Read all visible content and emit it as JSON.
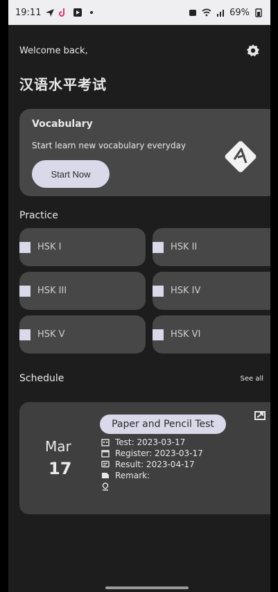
{
  "status_bar": {
    "time": "19:11",
    "battery": "69%"
  },
  "header": {
    "welcome": "Welcome back,",
    "title": "汉语水平考试"
  },
  "vocabulary_card": {
    "title": "Vocabulary",
    "subtitle": "Start learn new vocabulary everyday",
    "button": "Start Now"
  },
  "practice": {
    "label": "Practice",
    "levels": [
      "HSK I",
      "HSK II",
      "HSK III",
      "HSK IV",
      "HSK V",
      "HSK VI"
    ]
  },
  "schedule": {
    "label": "Schedule",
    "see_all": "See all",
    "item": {
      "month": "Mar",
      "day": "17",
      "test_type": "Paper and Pencil Test",
      "test": "Test: 2023-03-17",
      "register": "Register: 2023-03-17",
      "result": "Result: 2023-04-17",
      "remark": "Remark:",
      "location": ""
    }
  },
  "colors": {
    "background": "#1d1d1d",
    "card": "#474747",
    "pill": "#d9d9ea"
  },
  "icons": [
    "gear-icon",
    "translate-a-icon",
    "calendar-icon",
    "register-icon",
    "result-icon",
    "remark-icon",
    "location-icon",
    "open-card-icon"
  ]
}
